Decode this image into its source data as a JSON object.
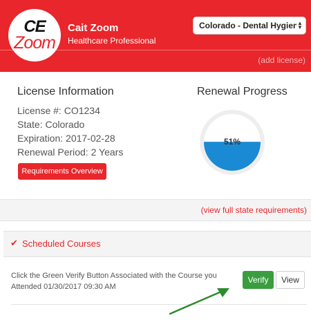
{
  "brand": {
    "logo_top": "CE",
    "logo_bottom": "Zoom",
    "accent": "#e8262b"
  },
  "user": {
    "name": "Cait Zoom",
    "role": "Healthcare Professional"
  },
  "license_select": {
    "value": "Colorado - Dental Hygiene - Li"
  },
  "add_license": "(add license)",
  "license_info": {
    "title": "License Information",
    "number": "License #: CO1234",
    "state": "State: Colorado",
    "expiration": "Expiration: 2017-02-28",
    "renewal_period": "Renewal Period: 2 Years",
    "requirements_button": "Requirements Overview"
  },
  "renewal": {
    "title": "Renewal Progress",
    "percent_label": "51%",
    "percent": 51,
    "fill_color": "#1a8ad4"
  },
  "view_full_requirements": "(view full state requirements)",
  "scheduled": {
    "label": "Scheduled Courses",
    "course_text": "Click the Green Verify Button Associated with the Course you Attended  01/30/2017  09:30 AM",
    "verify_label": "Verify",
    "view_label": "View",
    "arrow_color": "#2e8b2e"
  }
}
